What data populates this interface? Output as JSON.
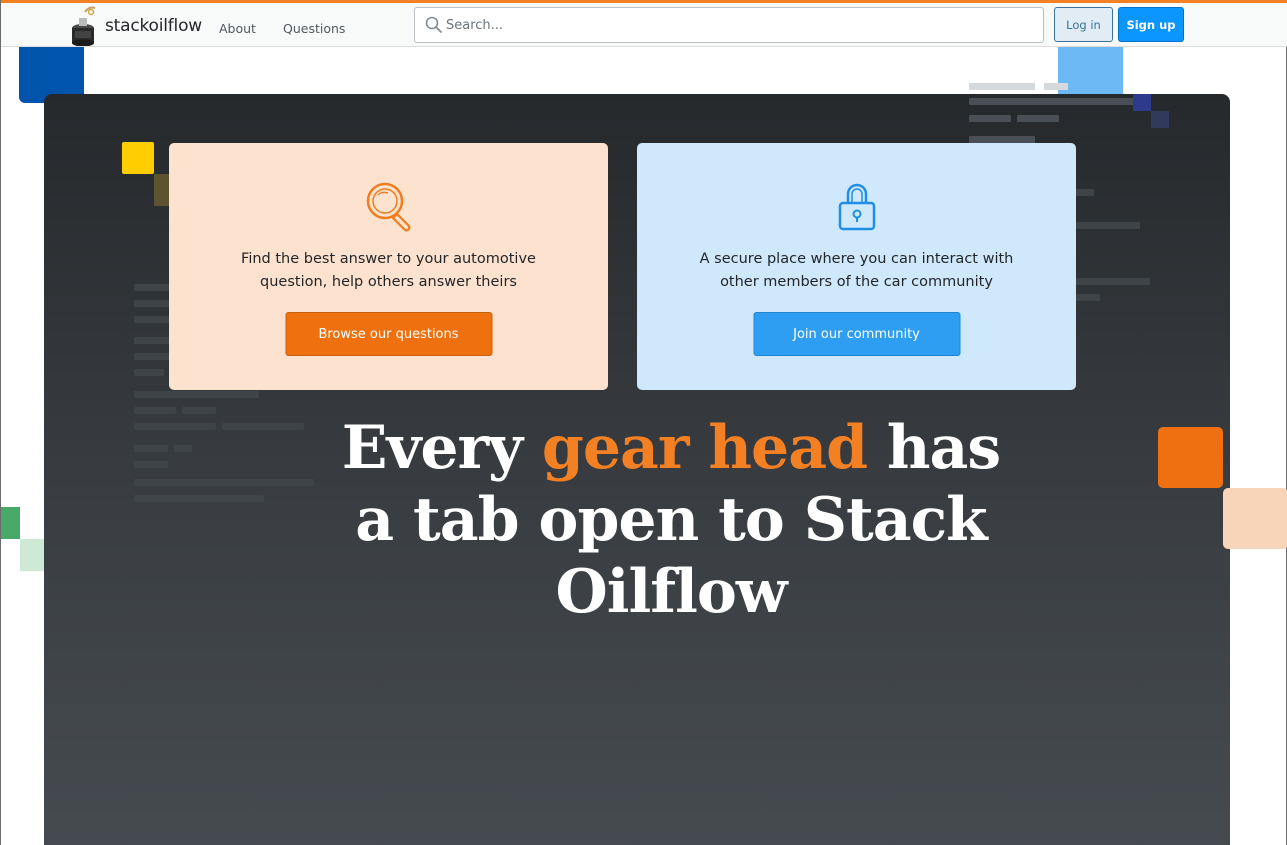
{
  "brand": {
    "name": "stackoilflow",
    "logo_icon": "oil-can-icon"
  },
  "nav": {
    "about": "About",
    "questions": "Questions"
  },
  "search": {
    "placeholder": "Search...",
    "icon": "search-icon"
  },
  "auth": {
    "login": "Log in",
    "signup": "Sign up"
  },
  "cards": [
    {
      "icon": "magnifier-icon",
      "text_line1": "Find the best answer to your automotive",
      "text_line2": "question, help others answer theirs",
      "button": "Browse our questions"
    },
    {
      "icon": "padlock-icon",
      "text_line1": "A secure place where you can interact with",
      "text_line2": "other members of the car community",
      "button": "Join our community"
    }
  ],
  "headline": {
    "before": "Every ",
    "accent": "gear head",
    "after": " has a tab open to Stack Oilflow"
  },
  "colors": {
    "accent_orange": "#f48024",
    "brand_blue": "#0a95ff",
    "hero_dark": "#2d3034",
    "card_orange_bg": "#fde3cf",
    "card_blue_bg": "#cfe8fc"
  }
}
